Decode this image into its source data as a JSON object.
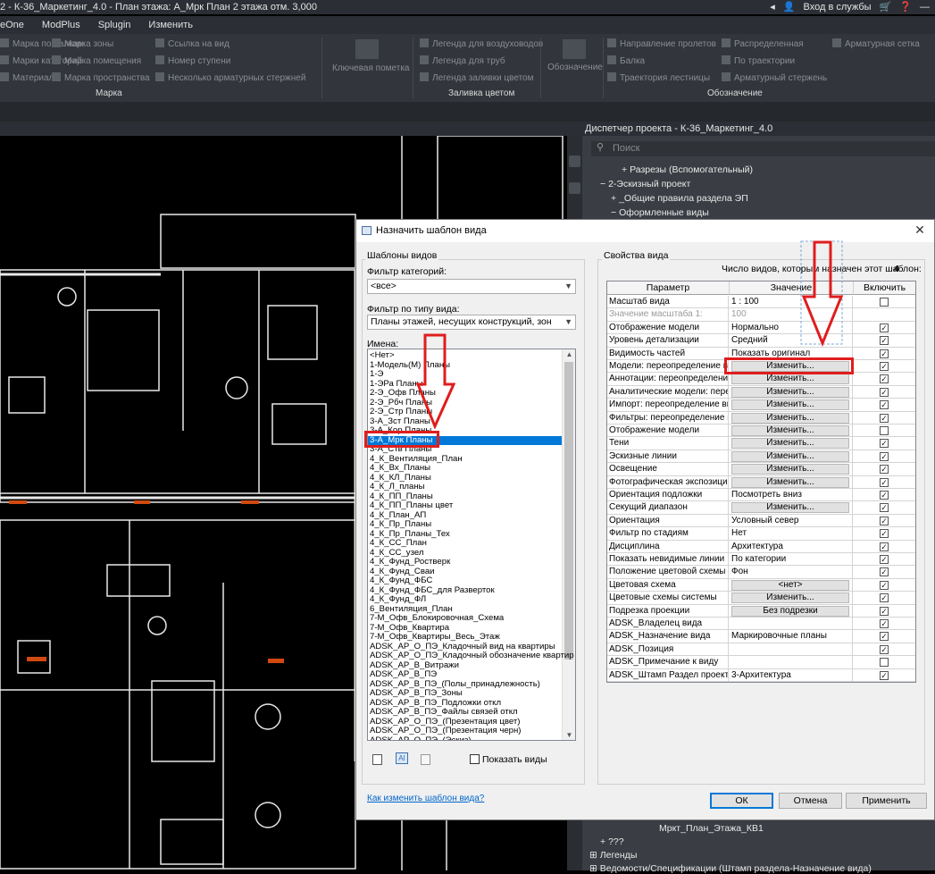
{
  "window": {
    "title": "2 - К-36_Маркетинг_4.0 - План этажа: А_Мрк План 2 этажа отм. 3,000",
    "signin": "Вход в службы"
  },
  "menu": [
    "eOne",
    "ModPlus",
    "Splugin",
    "Изменить"
  ],
  "ribbon": {
    "items": [
      "Марка по балкам",
      "Марка зоны",
      "Ссылка на вид",
      "Марки категорий",
      "Марка помещения",
      "Номер ступени",
      "Материала",
      "Марка пространства",
      "Несколько арматурных стержней",
      "Ключевая пометка",
      "Легенда для воздуховодов",
      "Легенда для труб",
      "Легенда заливки цветом",
      "Обозначение",
      "Направление пролетов",
      "Распределенная",
      "Балка",
      "По траектории",
      "Траектория лестницы",
      "Арматурный стержень",
      "Арматурная сетка"
    ],
    "groups": [
      "Марка",
      "Заливка цветом",
      "Обозначение"
    ]
  },
  "project_browser": {
    "title": "Диспетчер проекта - К-36_Маркетинг_4.0",
    "search_placeholder": "Поиск",
    "rows": [
      "Разрезы (Вспомогательный)",
      "2-Эскизный проект",
      "_Общие правила раздела ЭП",
      "Оформленные виды"
    ],
    "bottom_rows": [
      "Мркт_План_Этажа_КВ1",
      "???",
      "Легенды",
      "Ведомости/Спецификации (Штамп раздела-Назначение вида)"
    ]
  },
  "dialog": {
    "title": "Назначить шаблон вида",
    "left_legend": "Шаблоны видов",
    "filter_category_label": "Фильтр категорий:",
    "filter_category_value": "<все>",
    "filter_type_label": "Фильтр по типу вида:",
    "filter_type_value": "Планы этажей, несущих конструкций, зон",
    "names_label": "Имена:",
    "names": [
      "<Нет>",
      "1-Модель(М) Планы",
      "1-Э",
      "1-ЭРа Планы",
      "2-Э_Офв Планы",
      "2-Э_Рбч Планы",
      "2-Э_Стр Планы",
      "3-А_Зст Планы",
      "3-А_Кор Планы",
      "3-А_Мрк Планы",
      "3-А_Ств Планы",
      "4_К_Вентиляция_План",
      "4_К_Вх_Планы",
      "4_К_КЛ_Планы",
      "4_К_Л_планы",
      "4_К_ПП_Планы",
      "4_К_ПП_Планы цвет",
      "4_К_План_АП",
      "4_К_Пр_Планы",
      "4_К_Пр_Планы_Тех",
      "4_К_СС_План",
      "4_К_СС_узел",
      "4_К_Фунд_Ростверк",
      "4_К_Фунд_Сваи",
      "4_К_Фунд_ФБС",
      "4_К_Фунд_ФБС_для Разверток",
      "4_К_Фунд_ФЛ",
      "6_Вентиляция_План",
      "7-М_Офв_Блокировочная_Схема",
      "7-М_Офв_Квартира",
      "7-М_Офв_Квартиры_Весь_Этаж",
      "ADSK_АР_О_ПЭ_Кладочный вид на квартиры",
      "ADSK_АР_О_ПЭ_Кладочный обозначение квартир",
      "ADSK_АР_В_Витражи",
      "ADSK_АР_В_ПЭ",
      "ADSK_АР_В_ПЭ_(Полы_принадлежность)",
      "ADSK_АР_В_ПЭ_Зоны",
      "ADSK_АР_В_ПЭ_Подложки откл",
      "ADSK_АР_В_ПЭ_Файлы связей откл",
      "ADSK_АР_О_ПЭ_(Презентация цвет)",
      "ADSK_АР_О_ПЭ_(Презентация черн)",
      "ADSK_АР_О_ПЭ_(Эскиз)"
    ],
    "selected_index": 9,
    "show_views_label": "Показать виды",
    "right_legend": "Свойства вида",
    "count_label": "Число видов, которым назначен этот шаблон:",
    "count_value": "4",
    "table_headers": [
      "Параметр",
      "Значение",
      "Включить"
    ],
    "rows": [
      {
        "name": "Масштаб вида",
        "value": "1 : 100",
        "btn": false,
        "check": false,
        "gray": false
      },
      {
        "name": "Значение масштаба   1:",
        "value": "100",
        "btn": false,
        "check": null,
        "gray": true
      },
      {
        "name": "Отображение модели",
        "value": "Нормально",
        "btn": false,
        "check": true,
        "gray": false
      },
      {
        "name": "Уровень детализации",
        "value": "Средний",
        "btn": false,
        "check": true,
        "gray": false
      },
      {
        "name": "Видимость частей",
        "value": "Показать оригинал",
        "btn": false,
        "check": true,
        "gray": false
      },
      {
        "name": "Модели: переопределение ви",
        "value": "Изменить...",
        "btn": true,
        "check": true,
        "gray": false
      },
      {
        "name": "Аннотации: переопределение",
        "value": "Изменить...",
        "btn": true,
        "check": true,
        "gray": false
      },
      {
        "name": "Аналитические модели: перео",
        "value": "Изменить...",
        "btn": true,
        "check": true,
        "gray": false
      },
      {
        "name": "Импорт: переопределение ви",
        "value": "Изменить...",
        "btn": true,
        "check": true,
        "gray": false
      },
      {
        "name": "Фильтры: переопределение в",
        "value": "Изменить...",
        "btn": true,
        "check": true,
        "gray": false
      },
      {
        "name": "Отображение модели",
        "value": "Изменить...",
        "btn": true,
        "check": false,
        "gray": false
      },
      {
        "name": "Тени",
        "value": "Изменить...",
        "btn": true,
        "check": true,
        "gray": false
      },
      {
        "name": "Эскизные линии",
        "value": "Изменить...",
        "btn": true,
        "check": true,
        "gray": false
      },
      {
        "name": "Освещение",
        "value": "Изменить...",
        "btn": true,
        "check": true,
        "gray": false
      },
      {
        "name": "Фотографическая экспозиция",
        "value": "Изменить...",
        "btn": true,
        "check": true,
        "gray": false
      },
      {
        "name": "Ориентация подложки",
        "value": "Посмотреть вниз",
        "btn": false,
        "check": true,
        "gray": false
      },
      {
        "name": "Секущий диапазон",
        "value": "Изменить...",
        "btn": true,
        "check": true,
        "gray": false
      },
      {
        "name": "Ориентация",
        "value": "Условный север",
        "btn": false,
        "check": true,
        "gray": false
      },
      {
        "name": "Фильтр по стадиям",
        "value": "Нет",
        "btn": false,
        "check": true,
        "gray": false
      },
      {
        "name": "Дисциплина",
        "value": "Архитектура",
        "btn": false,
        "check": true,
        "gray": false
      },
      {
        "name": "Показать невидимые линии",
        "value": "По категории",
        "btn": false,
        "check": true,
        "gray": false
      },
      {
        "name": "Положение цветовой схемы",
        "value": "Фон",
        "btn": false,
        "check": true,
        "gray": false
      },
      {
        "name": "Цветовая схема",
        "value": "<нет>",
        "btn": true,
        "check": true,
        "gray": false
      },
      {
        "name": "Цветовые схемы системы",
        "value": "Изменить...",
        "btn": true,
        "check": true,
        "gray": false
      },
      {
        "name": "Подрезка проекции",
        "value": "Без подрезки",
        "btn": true,
        "check": true,
        "gray": false
      },
      {
        "name": "ADSK_Владелец вида",
        "value": "",
        "btn": false,
        "check": true,
        "gray": false
      },
      {
        "name": "ADSK_Назначение вида",
        "value": "Маркировочные планы",
        "btn": false,
        "check": true,
        "gray": false
      },
      {
        "name": "ADSK_Позиция",
        "value": "",
        "btn": false,
        "check": true,
        "gray": false
      },
      {
        "name": "ADSK_Примечание к виду",
        "value": "",
        "btn": false,
        "check": false,
        "gray": false
      },
      {
        "name": "ADSK_Штамп Раздел проекта",
        "value": "3-Архитектура",
        "btn": false,
        "check": true,
        "gray": false
      }
    ],
    "help_link": "Как изменить шаблон вида?",
    "ok": "ОК",
    "cancel": "Отмена",
    "apply": "Применить"
  },
  "colors": {
    "annotation": "#e01d1d",
    "selection": "#0078d7",
    "ui_dark": "#32363c"
  }
}
